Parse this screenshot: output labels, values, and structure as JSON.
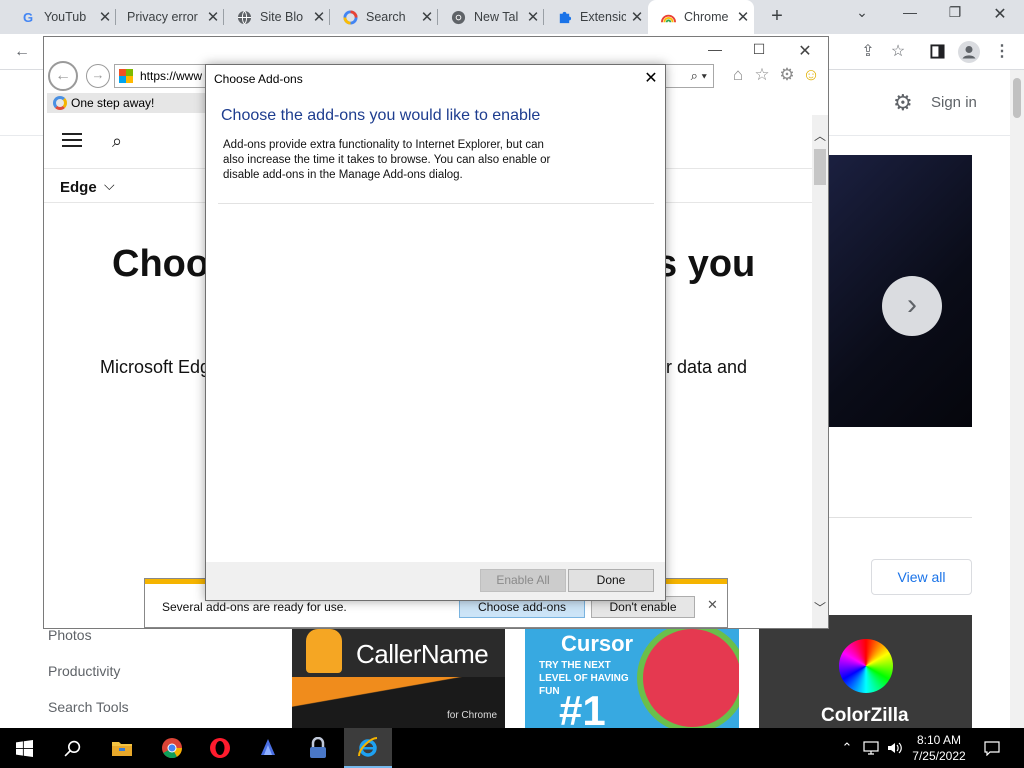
{
  "chrome": {
    "tabs": [
      {
        "title": "YouTub",
        "favicon": "G"
      },
      {
        "title": "Privacy error",
        "favicon": ""
      },
      {
        "title": "Site Blo",
        "favicon": "globe-icon"
      },
      {
        "title": "Search",
        "favicon": "google-color-icon"
      },
      {
        "title": "New Tal",
        "favicon": "chrome-icon"
      },
      {
        "title": "Extensic",
        "favicon": "puzzle-icon"
      },
      {
        "title": "Chrome",
        "favicon": "rainbow-icon"
      }
    ],
    "new_tab_symbol": "+",
    "page": {
      "sign_in": "Sign in",
      "view_all": "View all",
      "sidebar_links": [
        "Photos",
        "Productivity",
        "Search Tools"
      ],
      "cards": [
        {
          "name": "CallerName",
          "subtitle": "for Chrome"
        },
        {
          "name": "Cursor",
          "tagline": "TRY THE NEXT LEVEL OF HAVING FUN",
          "rank": "#1"
        },
        {
          "name": "ColorZilla"
        }
      ]
    }
  },
  "ie": {
    "url": "https://www",
    "tab_title": "One step away!",
    "content": {
      "edge_label": "Edge",
      "heading_left": "Choos",
      "heading_right": "s you",
      "para_left": "Microsoft Edg",
      "para_right": "ur data and"
    },
    "notification": {
      "message": "Several add-ons are ready for use.",
      "primary_button": "Choose add-ons",
      "secondary_button": "Don't enable"
    }
  },
  "dialog": {
    "title": "Choose Add-ons",
    "heading": "Choose the add-ons you would like to enable",
    "description": "Add-ons provide extra functionality to Internet Explorer, but can also increase the time it takes to browse. You can also enable or disable add-ons in the Manage Add-ons dialog.",
    "enable_all": "Enable All",
    "done": "Done"
  },
  "taskbar": {
    "time": "8:10 AM",
    "date": "7/25/2022"
  },
  "colors": {
    "dialog_heading": "#1e3d8f",
    "notification_stripe": "#f5b400",
    "taskbar": "#000000",
    "link_blue": "#1a73e8"
  }
}
